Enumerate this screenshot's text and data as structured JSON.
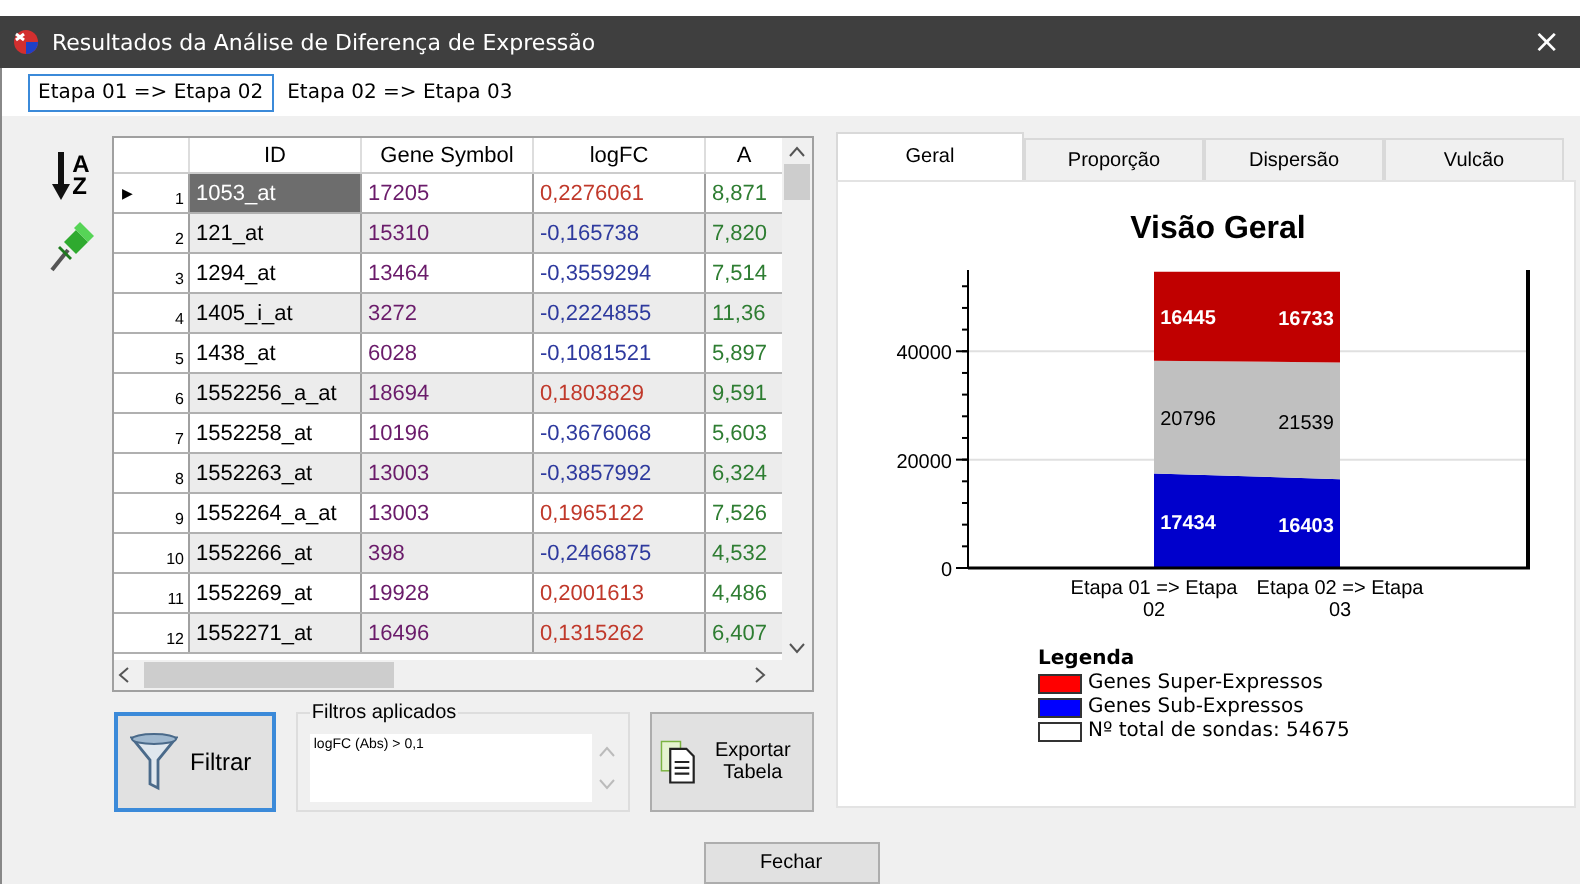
{
  "window": {
    "title": "Resultados da Análise de Diferença de Expressão",
    "close": "×"
  },
  "stage_tabs": [
    {
      "label": "Etapa 01 => Etapa 02",
      "selected": true
    },
    {
      "label": "Etapa 02 => Etapa 03",
      "selected": false
    }
  ],
  "sort_icon": {
    "top": "A",
    "bottom": "Z"
  },
  "table": {
    "columns": [
      "ID",
      "Gene Symbol",
      "logFC",
      "A"
    ],
    "row_marker": "▶",
    "rows": [
      {
        "number": "1",
        "id": "1053_at",
        "gene_symbol": "17205",
        "logfc": "0,2276061",
        "color": "#c0392b",
        "column_4": "8,871",
        "selected": true
      },
      {
        "number": "2",
        "id": "121_at",
        "gene_symbol": "15310",
        "logfc": "-0,165738",
        "color": "#2e3a9e",
        "column_4": "7,820",
        "selected": false
      },
      {
        "number": "3",
        "id": "1294_at",
        "gene_symbol": "13464",
        "logfc": "-0,3559294",
        "color": "#2e3a9e",
        "column_4": "7,514",
        "selected": false
      },
      {
        "number": "4",
        "id": "1405_i_at",
        "gene_symbol": "3272",
        "logfc": "-0,2224855",
        "color": "#2e3a9e",
        "column_4": "11,36",
        "selected": false
      },
      {
        "number": "5",
        "id": "1438_at",
        "gene_symbol": "6028",
        "logfc": "-0,1081521",
        "color": "#2e3a9e",
        "column_4": "5,897",
        "selected": false
      },
      {
        "number": "6",
        "id": "1552256_a_at",
        "gene_symbol": "18694",
        "logfc": "0,1803829",
        "color": "#c0392b",
        "column_4": "9,591",
        "selected": false
      },
      {
        "number": "7",
        "id": "1552258_at",
        "gene_symbol": "10196",
        "logfc": "-0,3676068",
        "color": "#2e3a9e",
        "column_4": "5,603",
        "selected": false
      },
      {
        "number": "8",
        "id": "1552263_at",
        "gene_symbol": "13003",
        "logfc": "-0,3857992",
        "color": "#2e3a9e",
        "column_4": "6,324",
        "selected": false
      },
      {
        "number": "9",
        "id": "1552264_a_at",
        "gene_symbol": "13003",
        "logfc": "0,1965122",
        "color": "#c0392b",
        "column_4": "7,526",
        "selected": false
      },
      {
        "number": "10",
        "id": "1552266_at",
        "gene_symbol": "398",
        "logfc": "-0,2466875",
        "color": "#2e3a9e",
        "column_4": "4,532",
        "selected": false
      },
      {
        "number": "11",
        "id": "1552269_at",
        "gene_symbol": "19928",
        "logfc": "0,2001613",
        "color": "#c0392b",
        "column_4": "4,486",
        "selected": false
      },
      {
        "number": "12",
        "id": "1552271_at",
        "gene_symbol": "16496",
        "logfc": "0,1315262",
        "color": "#c0392b",
        "column_4": "6,407",
        "selected": false
      }
    ]
  },
  "filter_button": "Filtrar",
  "filters": {
    "title": "Filtros aplicados",
    "text": "logFC (Abs) > 0,1"
  },
  "export_button": "Exportar Tabela",
  "chart_tabs": [
    {
      "label": "Geral",
      "selected": true
    },
    {
      "label": "Proporção",
      "selected": false
    },
    {
      "label": "Dispersão",
      "selected": false
    },
    {
      "label": "Vulcão",
      "selected": false
    }
  ],
  "chart_data": {
    "type": "area",
    "title": "Visão Geral",
    "categories": [
      "Etapa 01 => Etapa 02",
      "Etapa 02 => Etapa 03"
    ],
    "stacked": true,
    "ylim": [
      0,
      55000
    ],
    "yticks": [
      0,
      20000,
      40000
    ],
    "data_labels": true,
    "series": [
      {
        "name": "Genes Super-Expressos",
        "color": "#c00000",
        "values": [
          16445,
          16733
        ]
      },
      {
        "name": "Genes Sub-Expressos",
        "color": "#0000cc",
        "values": [
          17434,
          16403
        ]
      },
      {
        "name": "Nº total de sondas: 54675",
        "color": "#c0c0c0",
        "values": [
          20796,
          21539
        ]
      }
    ]
  },
  "legend": {
    "title": "Legenda",
    "items": [
      {
        "color": "#ff0000"
      },
      {
        "color": "#0000ff"
      },
      {
        "color": "#ffffff"
      }
    ]
  },
  "close_button": "Fechar"
}
